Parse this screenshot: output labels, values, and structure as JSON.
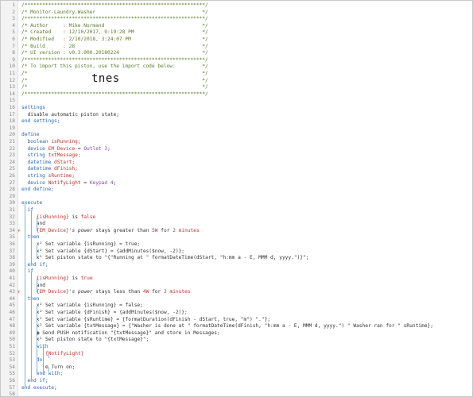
{
  "header": [
    "/*************************************************************/",
    "/* Monitor-Laundry.Washer                                    */",
    "/*************************************************************/",
    "/* Author     : Mike Normand                                 */",
    "/* Created    : 12/10/2017, 9:19:28 PM                       */",
    "/* Modified   : 2/10/2018, 3:24:07 PM                        */",
    "/* Build      : 28                                           */",
    "/* UI version : v0.3.000.20180224                            */",
    "/*************************************************************/",
    "/* To import this piston, use the import code below:         */",
    "/*                                                           */",
    "/*                                                           */",
    "/*                                                           */",
    "/*************************************************************/"
  ],
  "import_code": "tnes",
  "lines": [
    {
      "n": "1"
    },
    {
      "n": "2"
    },
    {
      "n": "3"
    },
    {
      "n": "4"
    },
    {
      "n": "5"
    },
    {
      "n": "6"
    },
    {
      "n": "7"
    },
    {
      "n": "8"
    },
    {
      "n": "9"
    },
    {
      "n": "10"
    },
    {
      "n": "11"
    },
    {
      "n": "12"
    },
    {
      "n": "13"
    },
    {
      "n": "14"
    },
    {
      "n": "15"
    },
    {
      "n": "16"
    },
    {
      "n": "17"
    },
    {
      "n": "18"
    },
    {
      "n": "19"
    },
    {
      "n": "20"
    },
    {
      "n": "21"
    },
    {
      "n": "22"
    },
    {
      "n": "23"
    },
    {
      "n": "24"
    },
    {
      "n": "25"
    },
    {
      "n": "26"
    },
    {
      "n": "27"
    },
    {
      "n": "28"
    },
    {
      "n": "29"
    },
    {
      "n": "30"
    },
    {
      "n": "31"
    },
    {
      "n": "32"
    },
    {
      "n": "33"
    },
    {
      "n": "34"
    },
    {
      "n": "35"
    },
    {
      "n": "36"
    },
    {
      "n": "37"
    },
    {
      "n": "38"
    },
    {
      "n": "39"
    },
    {
      "n": "40"
    },
    {
      "n": "41"
    },
    {
      "n": "42"
    },
    {
      "n": "43"
    },
    {
      "n": "44"
    },
    {
      "n": "45"
    },
    {
      "n": "46"
    },
    {
      "n": "47"
    },
    {
      "n": "48"
    },
    {
      "n": "49"
    },
    {
      "n": "50"
    },
    {
      "n": "51"
    },
    {
      "n": "52"
    },
    {
      "n": "53"
    },
    {
      "n": "54"
    },
    {
      "n": "55"
    },
    {
      "n": "56"
    },
    {
      "n": "57"
    },
    {
      "n": "58"
    }
  ],
  "code": {
    "settings": "settings",
    "disable_state": "disable automatic piston state;",
    "end_settings": "end settings;",
    "define": "define",
    "v_isRunning_type": "boolean",
    "v_isRunning": "isRunning;",
    "v_device_type": "device",
    "v_device": "EM_Device",
    "v_device_eq": "=",
    "v_device_val": "Outlet 3",
    "v_txt_type": "string",
    "v_txt": "txtMessage;",
    "v_dstart_type": "datetime",
    "v_dstart": "dStart;",
    "v_dfinish_type": "datetime",
    "v_dfinish": "dFinish;",
    "v_sruntime_type": "string",
    "v_sruntime": "sRuntime;",
    "v_notify_type": "device",
    "v_notify": "NotifyLight",
    "v_notify_eq": "=",
    "v_notify_val": "Keypad 4",
    "end_define": "end define;",
    "execute": "execute",
    "if1": "if",
    "cond1a_var": "{isRunning}",
    "cond1a_is": "is",
    "cond1a_val": "false",
    "and1": "and",
    "cond1b_dev": "{EM_Device}",
    "cond1b_attr": "'s power",
    "cond1b_op": "stays greater than",
    "cond1b_val": "5W",
    "cond1b_for": "for",
    "cond1b_dur": "2 minutes",
    "then1": "then",
    "set1a": "Set variable {isRunning} = true;",
    "set1b": "Set variable {dStart} = {addMinutes($now, -2)};",
    "set1c": "Set piston state to \"{\"Running at \" formatDateTime(dStart, \"h:mm a - E, MMM d, yyyy.\")}\";",
    "endif1": "end if;",
    "if2": "if",
    "cond2a_var": "{isRunning}",
    "cond2a_is": "is",
    "cond2a_val": "true",
    "and2": "and",
    "cond2b_dev": "{EM_Device}",
    "cond2b_attr": "'s power",
    "cond2b_op": "stays less than",
    "cond2b_val": "4W",
    "cond2b_for": "for",
    "cond2b_dur": "2 minutes",
    "then2": "then",
    "set2a": "Set variable {isRunning} = false;",
    "set2b": "Set variable {dFinish} = {addMinutes($now, -2)};",
    "set2c": "Set variable {sRuntime} = {formatDuration(dFinish - dStart, true, \"m\") \".\"};",
    "set2d": "Set variable {txtMessage} = {\"Washer is done at \" formatDateTime(dFinish, \"h:mm a - E, MMM d, yyyy.\") \" Washer ran for \" sRuntime};",
    "set2e": "Send PUSH notification \"{txtMessage}\" and store in Messages;",
    "set2f": "Set piston state to \"{txtMessage}\";",
    "with": "with",
    "with_dev": "{NotifyLight}",
    "do": "do",
    "turn_on": "Turn on;",
    "end_with": "end with;",
    "endif2": "end if;",
    "end_execute": "end execute;"
  },
  "colors": {
    "comment": "#5a7a28",
    "keyword": "#2a67b1",
    "variable": "#b8372f",
    "guide": "#7fb0d8",
    "flash": "#e4471f"
  }
}
